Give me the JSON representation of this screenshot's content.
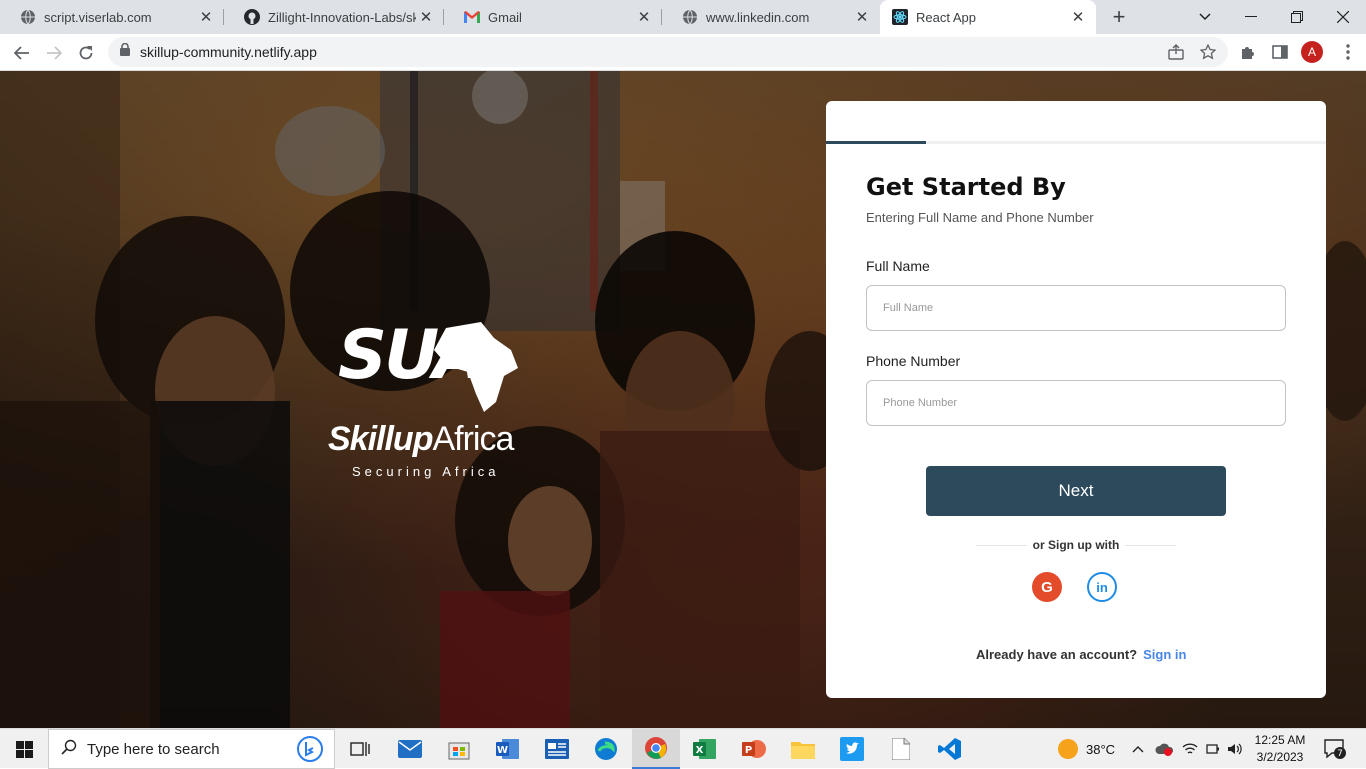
{
  "browser": {
    "tabs": [
      {
        "title": "script.viserlab.com",
        "icon": "globe-icon"
      },
      {
        "title": "Zillight-Innovation-Labs/skillu",
        "icon": "github-icon"
      },
      {
        "title": "Gmail",
        "icon": "gmail-icon"
      },
      {
        "title": "www.linkedin.com",
        "icon": "globe-icon"
      },
      {
        "title": "React App",
        "icon": "react-icon"
      }
    ],
    "url": "skillup-community.netlify.app",
    "profile_initial": "A"
  },
  "logo": {
    "mark": "SUA",
    "name_bold": "Skillup",
    "name_light": "Africa",
    "tagline": "Securing Africa"
  },
  "form": {
    "progress": 0.2,
    "title": "Get Started By",
    "subtitle": "Entering Full Name and Phone Number",
    "full_name_label": "Full Name",
    "full_name_placeholder": "Full Name",
    "phone_label": "Phone Number",
    "phone_placeholder": "Phone Number",
    "next_label": "Next",
    "divider_text": "or Sign up with",
    "google_letter": "G",
    "linkedin_text": "in",
    "account_prompt": "Already have an account?",
    "signin_label": "Sign in"
  },
  "taskbar": {
    "search_placeholder": "Type here to search",
    "temperature": "38°C",
    "time": "12:25 AM",
    "date": "3/2/2023",
    "notification_count": "7"
  },
  "colors": {
    "accent": "#2c4a5c",
    "link": "#4a86e8",
    "google": "#e34b2a",
    "linkedin": "#1f8ce6"
  }
}
